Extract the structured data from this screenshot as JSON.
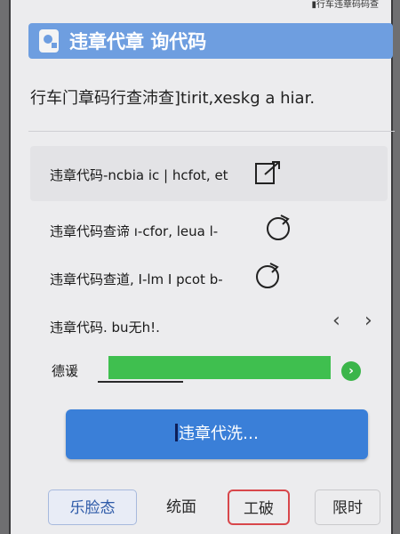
{
  "status_bar": {
    "text": "▮行车违章码码查"
  },
  "header": {
    "title": "违章代章 询代码",
    "icon": "clipboard-search-icon"
  },
  "subtitle": "行车门章码行查沛查]tirit,xeskg a hiar.",
  "rows": [
    {
      "label": "违章代码-ncbia ic | hcfot, et",
      "icon": "share-box-icon"
    },
    {
      "label": "违章代码查谛 ı-cfor, leua l-",
      "icon": "refresh-cycle-icon"
    },
    {
      "label": "违章代码查道, I-lm I pcot b-",
      "icon": "refresh-cycle-icon"
    },
    {
      "label": "违章代码. bu无h!.",
      "nav_prev": "‹",
      "nav_next": "›"
    }
  ],
  "input_field": {
    "label": "德谖",
    "value_hidden": true,
    "go_icon": "arrow-right-icon",
    "go_label": "›"
  },
  "primary_button": {
    "label": "违章代洗…"
  },
  "bottom_tabs": [
    {
      "label": "乐脸态"
    },
    {
      "label": "统面"
    },
    {
      "label": "工破"
    },
    {
      "label": "限时"
    }
  ],
  "colors": {
    "accent": "#3a7fd8",
    "header": "#6e9ee0",
    "highlight_green": "#3fbf4f",
    "danger_border": "#d8474b"
  }
}
